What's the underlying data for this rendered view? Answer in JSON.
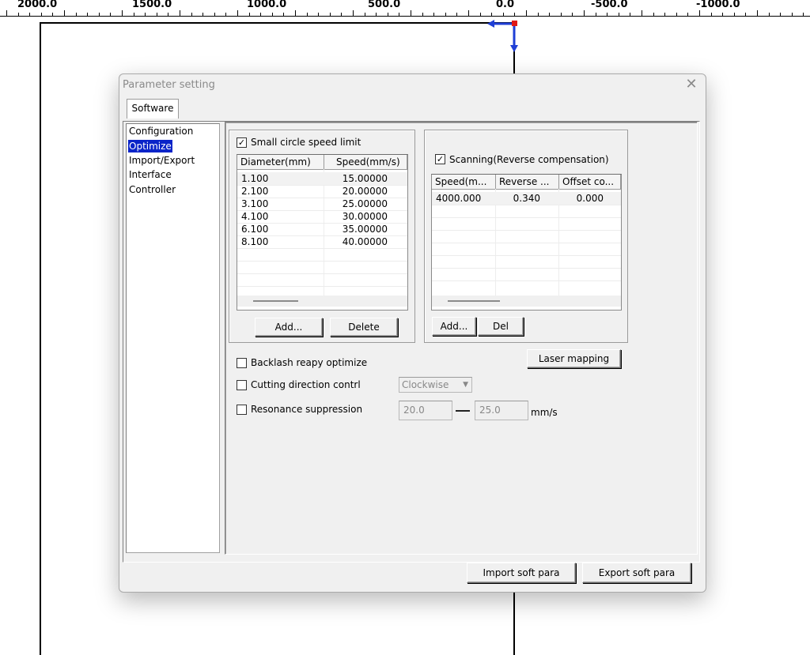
{
  "ruler": {
    "labels": [
      "2000.0",
      "1500.0",
      "1000.0",
      "500.0",
      "0.0",
      "-500.0",
      "-1000.0"
    ]
  },
  "colors": {
    "selection": "#0a24c8",
    "origin_marker": "#e01818",
    "axis_arrow": "#1f3fd6"
  },
  "dialog": {
    "title": "Parameter setting",
    "close_icon": "close-icon",
    "tab": "Software",
    "nav_items": [
      "Configuration",
      "Optimize",
      "Import/Export",
      "Interface",
      "Controller"
    ],
    "selected_nav": "Optimize",
    "small_circle": {
      "checkbox_label": "Small circle speed limit",
      "checked": true,
      "columns": [
        "Diameter(mm)",
        "Speed(mm/s)"
      ],
      "rows": [
        [
          "1.100",
          "15.00000"
        ],
        [
          "2.100",
          "20.00000"
        ],
        [
          "3.100",
          "25.00000"
        ],
        [
          "4.100",
          "30.00000"
        ],
        [
          "6.100",
          "35.00000"
        ],
        [
          "8.100",
          "40.00000"
        ]
      ],
      "add_label": "Add...",
      "delete_label": "Delete"
    },
    "scanning": {
      "checkbox_label": "Scanning(Reverse compensation)",
      "checked": true,
      "columns": [
        "Speed(m...",
        "Reverse ...",
        "Offset co..."
      ],
      "rows": [
        [
          "4000.000",
          "0.340",
          "0.000"
        ]
      ],
      "add_label": "Add...",
      "del_label": "Del"
    },
    "laser_mapping_label": "Laser mapping",
    "backlash_label": "Backlash reapy optimize",
    "cutting_direction_label": "Cutting direction contrl",
    "cutting_direction_value": "Clockwise",
    "resonance_label": "Resonance suppression",
    "resonance_min": "20.0",
    "resonance_max": "25.0",
    "resonance_unit": "mm/s",
    "import_label": "Import soft para",
    "export_label": "Export soft para"
  }
}
